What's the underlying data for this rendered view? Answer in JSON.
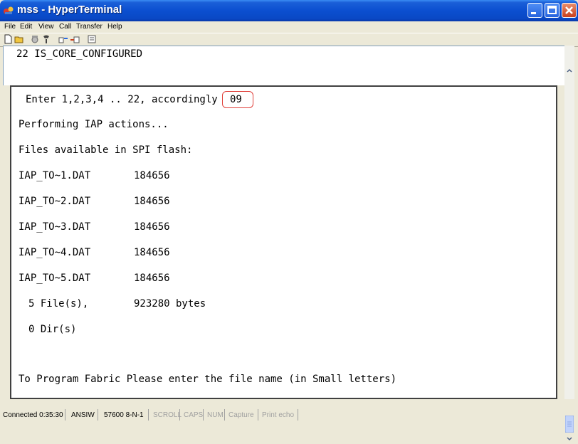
{
  "window": {
    "title": "mss - HyperTerminal"
  },
  "menubar": {
    "items": [
      "File",
      "Edit",
      "View",
      "Call",
      "Transfer",
      "Help"
    ]
  },
  "toolbar": {
    "icons": [
      "new-icon",
      "open-icon",
      "call-icon",
      "disconnect-icon",
      "send-icon",
      "receive-icon",
      "properties-icon"
    ]
  },
  "terminal": {
    "top_line": "22 IS_CORE_CONFIGURED",
    "prompt": "Enter 1,2,3,4 .. 22, accordingly",
    "prompt_value": "09",
    "performing": "Performing IAP actions...",
    "files_header": "Files available in SPI flash:",
    "files": [
      {
        "name": "IAP_TO~1.DAT",
        "size": "184656"
      },
      {
        "name": "IAP_TO~2.DAT",
        "size": "184656"
      },
      {
        "name": "IAP_TO~3.DAT",
        "size": "184656"
      },
      {
        "name": "IAP_TO~4.DAT",
        "size": "184656"
      },
      {
        "name": "IAP_TO~5.DAT",
        "size": "184656"
      }
    ],
    "file_count": "5 File(s),",
    "total_bytes": "923280 bytes",
    "dir_count": "0 Dir(s)",
    "program_prompt": "To Program Fabric Please enter the file name (in Small letters)"
  },
  "statusbar": {
    "connected": "Connected 0:35:30",
    "emulation": "ANSIW",
    "settings": "57600 8-N-1",
    "scroll": "SCROLL",
    "caps": "CAPS",
    "num": "NUM",
    "capture": "Capture",
    "print_echo": "Print echo"
  },
  "colors": {
    "titlebar": "#0b4fd0",
    "highlight": "#e0403a"
  }
}
